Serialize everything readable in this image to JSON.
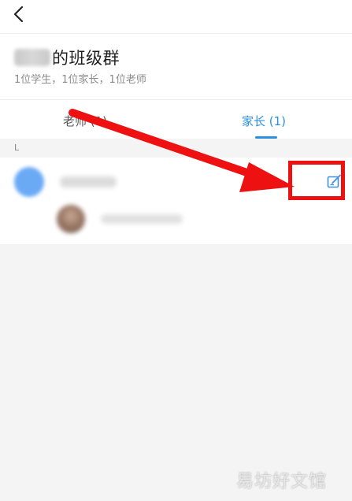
{
  "header": {
    "back_icon": "chevron-left-icon",
    "group_title": "的班级群",
    "group_subtitle": "1位学生，1位家长，1位老师"
  },
  "tabs": [
    {
      "label": "老师 (1)",
      "active": false
    },
    {
      "label": "家长 (1)",
      "active": true
    }
  ],
  "accent_color": "#2c8fe0",
  "annotation_color": "#ee1111",
  "section_letter": "L",
  "member": {
    "edit_icon": "edit-icon"
  },
  "watermark": "易坊好文馆"
}
